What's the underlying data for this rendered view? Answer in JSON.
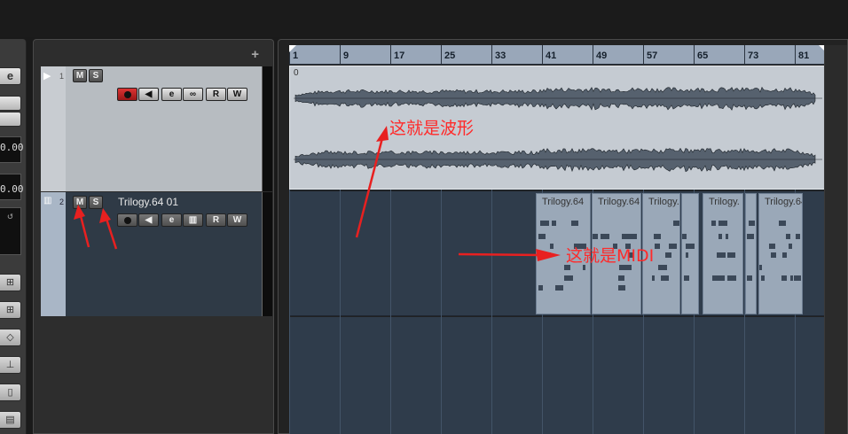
{
  "inspector": {
    "edit_icon": "e",
    "value_top": "0.00",
    "value_bottom": "0.00"
  },
  "tracklist": {
    "add_button": "+",
    "tracks": [
      {
        "number": "1",
        "type": "audio",
        "mute": "M",
        "solo": "S",
        "record": "record",
        "monitor": "monitor",
        "edit": "e",
        "link": "link",
        "read": "R",
        "write": "W"
      },
      {
        "number": "2",
        "type": "midi",
        "name": "Trilogy.64 01",
        "mute": "M",
        "solo": "S",
        "read": "R",
        "write": "W"
      }
    ]
  },
  "ruler": {
    "marks": [
      "1",
      "9",
      "17",
      "25",
      "33",
      "41",
      "49",
      "57",
      "65",
      "73",
      "81"
    ]
  },
  "audio_event": {
    "label": "0"
  },
  "midi_events": [
    {
      "label": "Trilogy.64"
    },
    {
      "label": "Trilogy.64"
    },
    {
      "label": "Trilogy.6"
    },
    {
      "label": ""
    },
    {
      "label": "Trilogy."
    },
    {
      "label": ""
    },
    {
      "label": "Trilogy.64"
    }
  ],
  "annotations": {
    "waveform": "这就是波形",
    "midi": "这就是MIDI"
  },
  "colors": {
    "annotation": "#ff2a2a",
    "ruler": "#99a7b9",
    "lane": "#2f3c4b",
    "audio_event": "#c5cbd2",
    "midi_event": "#9aa8b8",
    "record_active": "#c82020"
  }
}
